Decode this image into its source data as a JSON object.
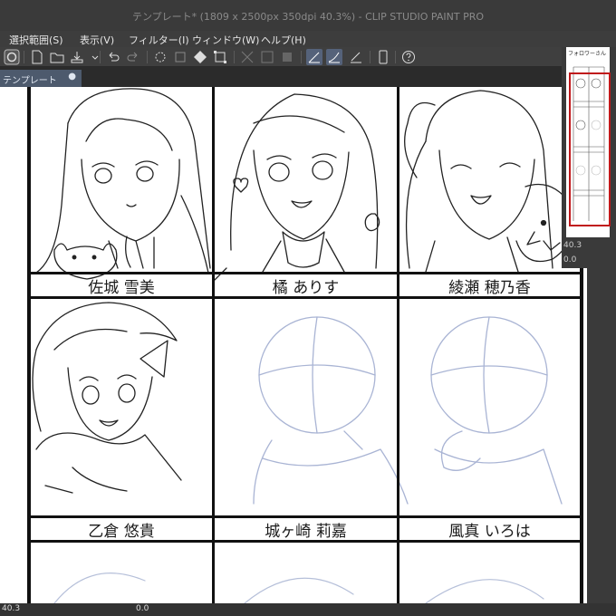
{
  "window": {
    "title": "テンプレート* (1809 x 2500px 350dpi 40.3%) - CLIP STUDIO PAINT PRO"
  },
  "menu": {
    "items": [
      {
        "label": "選択範囲(S)"
      },
      {
        "label": "表示(V)"
      },
      {
        "label": "フィルター(I)"
      },
      {
        "label": "ウィンドウ(W)"
      },
      {
        "label": "ヘルプ(H)"
      }
    ]
  },
  "toolbar": {
    "icons": [
      "clip-studio-logo-icon",
      "new-file-icon",
      "open-file-icon",
      "save-icon",
      "undo-icon",
      "redo-icon",
      "clear-icon",
      "fill-icon",
      "transform-icon",
      "ruler-icon",
      "pen-pressure-icon",
      "stabilizer-icon",
      "help-icon"
    ]
  },
  "document_tab": {
    "label": "テンプレート",
    "modified_marker": "●"
  },
  "template": {
    "names": [
      "佐城 雪美",
      "橘 ありす",
      "綾瀬 穂乃香",
      "乙倉 悠貴",
      "城ヶ崎 莉嘉",
      "風真 いろは"
    ]
  },
  "navigator": {
    "page_title": "フォロワーさん",
    "zoom": "40.3",
    "rotation": "0.0"
  },
  "status": {
    "zoom": "40.3",
    "rotation": "0.0"
  },
  "colors": {
    "accent_frame": "#c0191b",
    "active_tool": "#55627a",
    "tab": "#4d5a6d"
  }
}
